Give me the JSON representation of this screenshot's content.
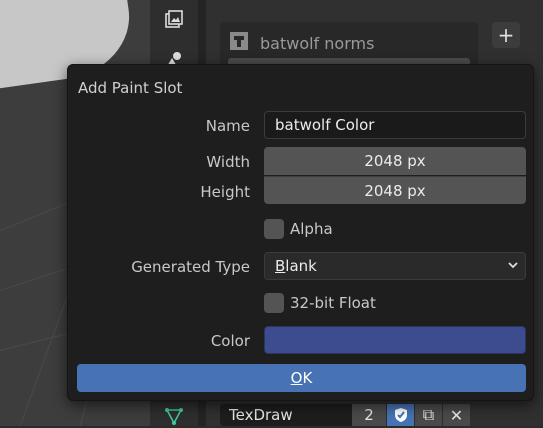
{
  "properties_panel": {
    "slot_item_label": "batwolf norms",
    "add_button": "+",
    "texture_name": "TexDraw",
    "users_count": "2",
    "new_icon": "⧉",
    "close_icon": "✕"
  },
  "dialog": {
    "title": "Add Paint Slot",
    "name_label": "Name",
    "name_value": "batwolf Color",
    "width_label": "Width",
    "width_value": "2048 px",
    "height_label": "Height",
    "height_value": "2048 px",
    "alpha_label": "Alpha",
    "alpha_checked": false,
    "generated_type_label": "Generated Type",
    "generated_type_value_first": "B",
    "generated_type_value_rest": "lank",
    "float_label": "32-bit Float",
    "float_checked": false,
    "color_label": "Color",
    "color_value": "#3d4b8f",
    "ok_first": "O",
    "ok_rest": "K"
  },
  "colors": {
    "accent": "#4772b3",
    "paint_color": "#3d4b8f"
  }
}
